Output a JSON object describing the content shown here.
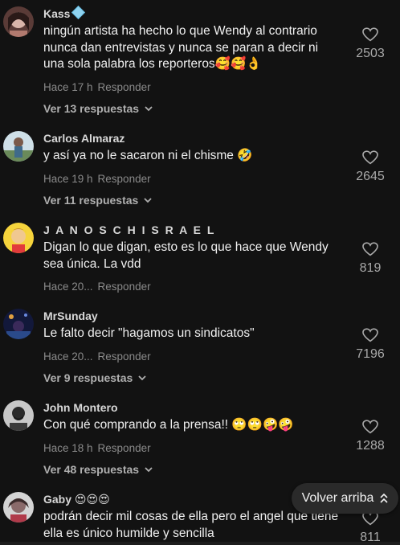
{
  "comments": [
    {
      "user": "Kass",
      "text": "ningún artista ha hecho lo que Wendy al contrario nunca dan entrevistas y nunca se paran a decir ni una sola palabra los reporteros🥰🥰👌",
      "time": "Hace 17 h",
      "reply": "Responder",
      "replies": "Ver 13 respuestas",
      "likes": "2503",
      "avatar_color": "#c9a7a0"
    },
    {
      "user": "Carlos Almaraz",
      "text": "y así ya no le sacaron ni el chisme 🤣",
      "time": "Hace 19 h",
      "reply": "Responder",
      "replies": "Ver 11 respuestas",
      "likes": "2645",
      "avatar_color": "#7fa0b8"
    },
    {
      "user": "J A N O S C H I S R A E L",
      "text": "Digan lo que digan, esto es lo que hace que Wendy sea única. La vdd",
      "time": "Hace 20...",
      "reply": "Responder",
      "replies": "",
      "likes": "819",
      "avatar_color": "#f2d23a"
    },
    {
      "user": "MrSunday",
      "text": "Le falto decir \"hagamos un sindicatos\"",
      "time": "Hace 20...",
      "reply": "Responder",
      "replies": "Ver 9 respuestas",
      "likes": "7196",
      "avatar_color": "#2c3a6e"
    },
    {
      "user": "John Montero",
      "text": "Con qué comprando a la prensa!! 🙄🙄🤪🤪",
      "time": "Hace 18 h",
      "reply": "Responder",
      "replies": "Ver 48 respuestas",
      "likes": "1288",
      "avatar_color": "#9a9a9a"
    },
    {
      "user": "Gaby 😍😍😍",
      "text": "podrán decir mil cosas de ella pero el angel que tiene ella es único humilde y sencilla",
      "time": "",
      "reply": "",
      "replies": "",
      "likes": "811",
      "avatar_color": "#c7c7c7"
    }
  ],
  "back_to_top": "Volver arriba",
  "icons": {
    "heart": "heart-outline-icon",
    "chevron": "chevron-down-icon",
    "arrow": "double-chevron-up-icon"
  }
}
